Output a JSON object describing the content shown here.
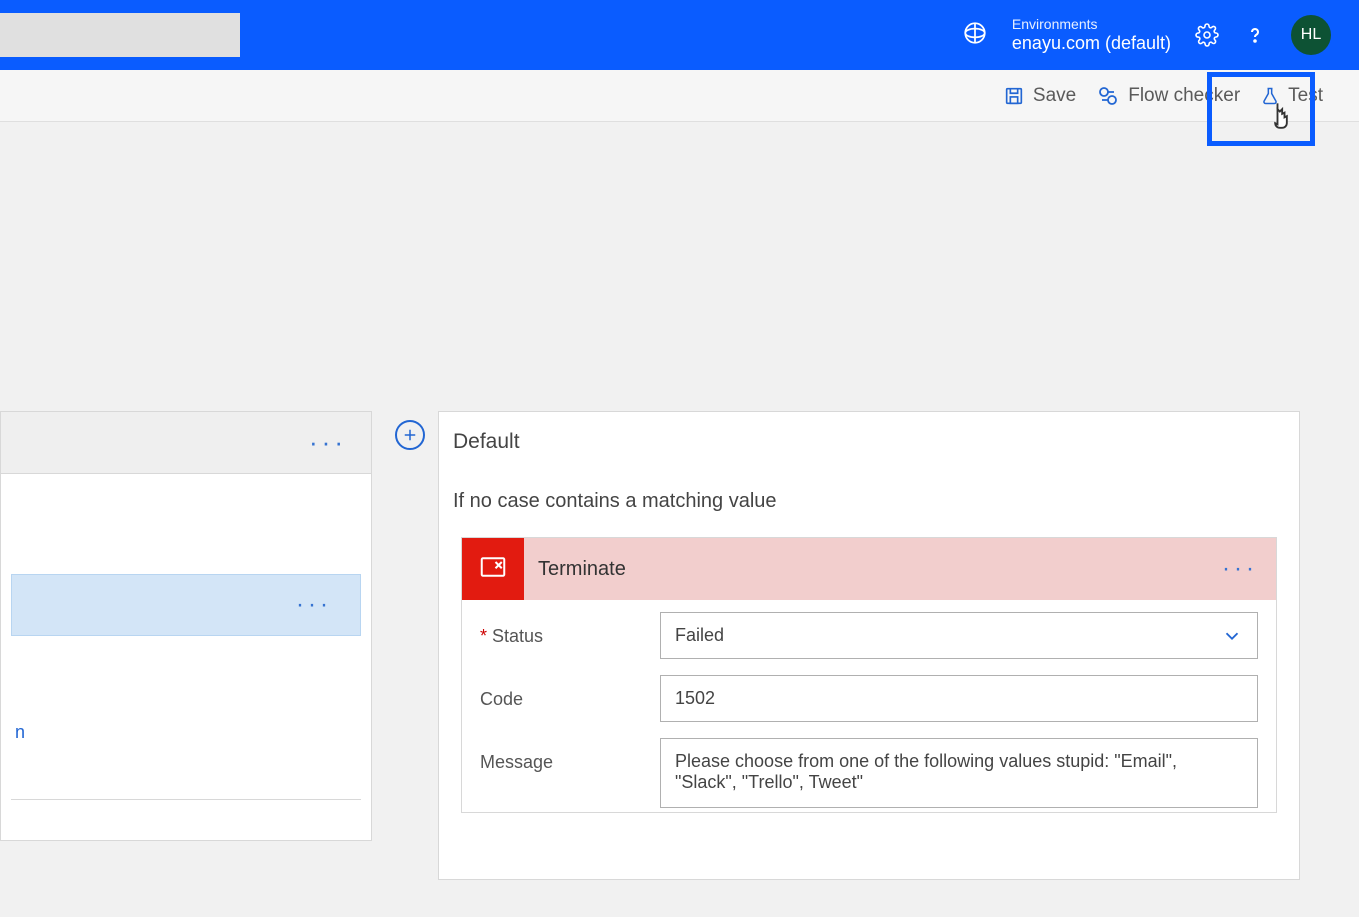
{
  "header": {
    "search_value": "",
    "env_label": "Environments",
    "env_name": "enayu.com (default)",
    "avatar_initials": "HL"
  },
  "toolbar": {
    "save_label": "Save",
    "flow_checker_label": "Flow checker",
    "test_label": "Test"
  },
  "left_panel": {
    "trailing_text": "n"
  },
  "case": {
    "title": "Default",
    "description": "If no case contains a matching value"
  },
  "action": {
    "title": "Terminate",
    "fields": {
      "status": {
        "label": "Status",
        "required": true,
        "value": "Failed"
      },
      "code": {
        "label": "Code",
        "value": "1502"
      },
      "message": {
        "label": "Message",
        "value": "Please choose from one of the following values stupid: \"Email\", \"Slack\", \"Trello\", Tweet\""
      }
    }
  }
}
